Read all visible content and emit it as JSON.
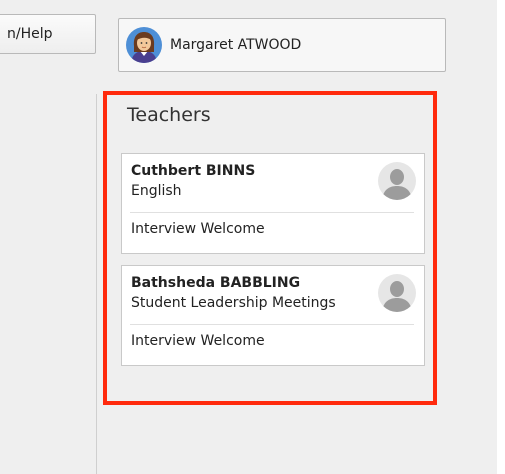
{
  "toolbar": {
    "help_label": "n/Help"
  },
  "user": {
    "name": "Margaret ATWOOD",
    "avatar_icon": "user-avatar-female-icon"
  },
  "teachers_panel": {
    "title": "Teachers",
    "highlight_color": "#ff2a0d",
    "teachers": [
      {
        "name": "Cuthbert BINNS",
        "subject": "English",
        "status": "Interview Welcome",
        "avatar_icon": "default-avatar-icon"
      },
      {
        "name": "Bathsheda BABBLING",
        "subject": "Student Leadership Meetings",
        "status": "Interview Welcome",
        "avatar_icon": "default-avatar-icon"
      }
    ]
  }
}
